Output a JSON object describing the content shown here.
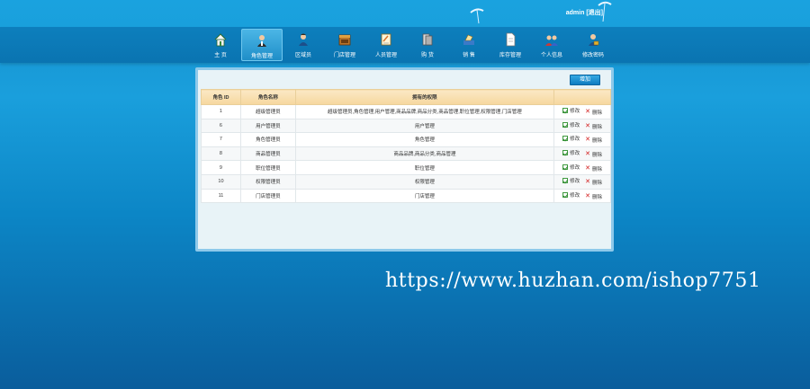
{
  "header": {
    "user_text": "admin [退出]"
  },
  "nav": {
    "items": [
      {
        "label": "主 页",
        "icon": "home-icon"
      },
      {
        "label": "角色管理",
        "icon": "role-icon"
      },
      {
        "label": "区域员",
        "icon": "staff-icon"
      },
      {
        "label": "门店管理",
        "icon": "store-icon"
      },
      {
        "label": "人员管理",
        "icon": "personnel-icon"
      },
      {
        "label": "购 货",
        "icon": "purchase-icon"
      },
      {
        "label": "销 售",
        "icon": "sales-icon"
      },
      {
        "label": "库存管理",
        "icon": "inventory-icon"
      },
      {
        "label": "个人信息",
        "icon": "profile-icon"
      },
      {
        "label": "修改密码",
        "icon": "password-icon"
      }
    ],
    "active_index": 1
  },
  "panel": {
    "add_label": "增加"
  },
  "table": {
    "headers": [
      "角色 ID",
      "角色名称",
      "拥有的权限",
      ""
    ],
    "edit_label": "修改",
    "delete_label": "删除",
    "rows": [
      {
        "id": "1",
        "name": "超级管理员",
        "perm": "超级管理员,角色管理,用户管理,商品品牌,商品分类,商品管理,职位管理,权限管理,门店管理"
      },
      {
        "id": "6",
        "name": "用户管理员",
        "perm": "用户管理"
      },
      {
        "id": "7",
        "name": "角色管理员",
        "perm": "角色管理"
      },
      {
        "id": "8",
        "name": "商品管理员",
        "perm": "商品品牌,商品分类,商品管理"
      },
      {
        "id": "9",
        "name": "职位管理员",
        "perm": "职位管理"
      },
      {
        "id": "10",
        "name": "权限管理员",
        "perm": "权限管理"
      },
      {
        "id": "11",
        "name": "门店管理员",
        "perm": "门店管理"
      }
    ]
  },
  "watermark": "https://www.huzhan.com/ishop7751",
  "colors": {
    "accent": "#1591cf",
    "header_row": "#f6d79e",
    "edit": "#3f9a3f",
    "delete": "#d21b1b"
  }
}
